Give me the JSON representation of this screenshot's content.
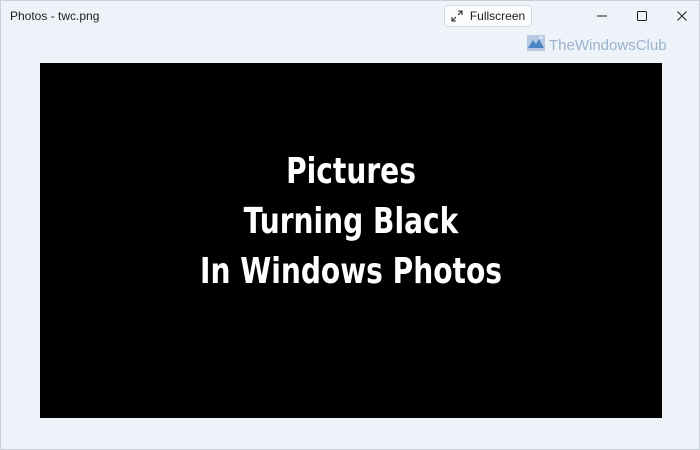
{
  "window": {
    "title": "Photos - twc.png"
  },
  "toolbar": {
    "fullscreen_label": "Fullscreen",
    "fullscreen_icon": "expand-icon"
  },
  "window_controls": {
    "minimize_icon": "minimize-icon",
    "maximize_icon": "maximize-icon",
    "close_icon": "close-icon"
  },
  "watermark": {
    "text": "TheWindowsClub"
  },
  "image": {
    "background": "#000000",
    "text_color": "#ffffff",
    "lines": [
      "Pictures",
      "Turning Black",
      "In Windows Photos"
    ]
  }
}
